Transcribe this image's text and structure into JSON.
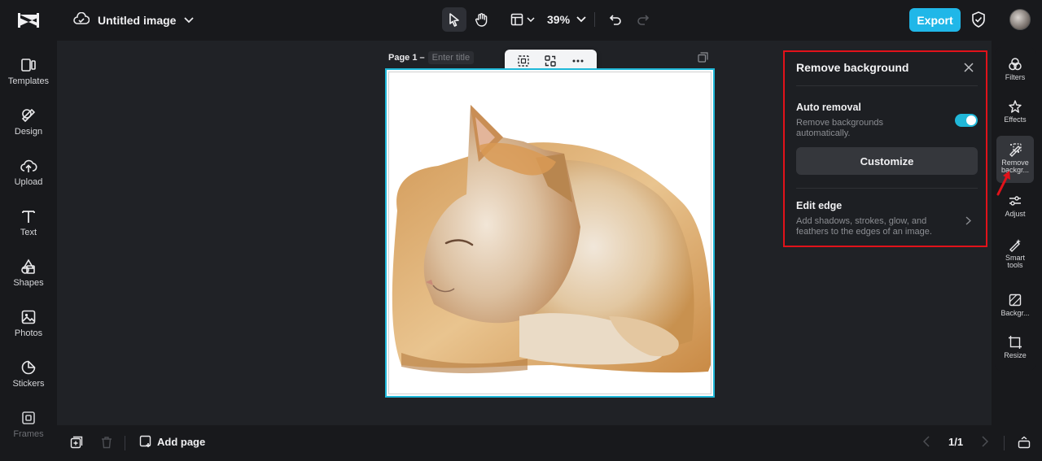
{
  "topbar": {
    "doc_title": "Untitled image",
    "zoom": "39%",
    "export_label": "Export"
  },
  "left_sidebar": {
    "items": [
      {
        "label": "Templates",
        "icon": "templates-icon"
      },
      {
        "label": "Design",
        "icon": "design-icon"
      },
      {
        "label": "Upload",
        "icon": "upload-icon"
      },
      {
        "label": "Text",
        "icon": "text-icon"
      },
      {
        "label": "Shapes",
        "icon": "shapes-icon"
      },
      {
        "label": "Photos",
        "icon": "photos-icon"
      },
      {
        "label": "Stickers",
        "icon": "stickers-icon"
      },
      {
        "label": "Frames",
        "icon": "frames-icon"
      }
    ]
  },
  "canvas": {
    "page_label": "Page 1 –",
    "title_placeholder": "Enter title"
  },
  "remove_bg_panel": {
    "title": "Remove background",
    "auto_removal_title": "Auto removal",
    "auto_removal_desc": "Remove backgrounds automatically.",
    "auto_removal_enabled": true,
    "customize_label": "Customize",
    "edit_edge_title": "Edit edge",
    "edit_edge_desc": "Add shadows, strokes, glow, and feathers to the edges of an image."
  },
  "right_rail": {
    "items": [
      {
        "label": "Filters",
        "icon": "filters-icon"
      },
      {
        "label": "Effects",
        "icon": "effects-icon"
      },
      {
        "label": "Remove backgr...",
        "icon": "remove-background-icon",
        "active": true
      },
      {
        "label": "Adjust",
        "icon": "adjust-icon"
      },
      {
        "label": "Smart tools",
        "icon": "smart-tools-icon"
      },
      {
        "label": "Backgr...",
        "icon": "background-icon"
      },
      {
        "label": "Resize",
        "icon": "resize-icon"
      }
    ]
  },
  "bottombar": {
    "add_page_label": "Add page",
    "pager": "1/1"
  },
  "colors": {
    "accent": "#20b7e8",
    "highlight_border": "#e1121a",
    "selection": "#1fb8d8"
  }
}
